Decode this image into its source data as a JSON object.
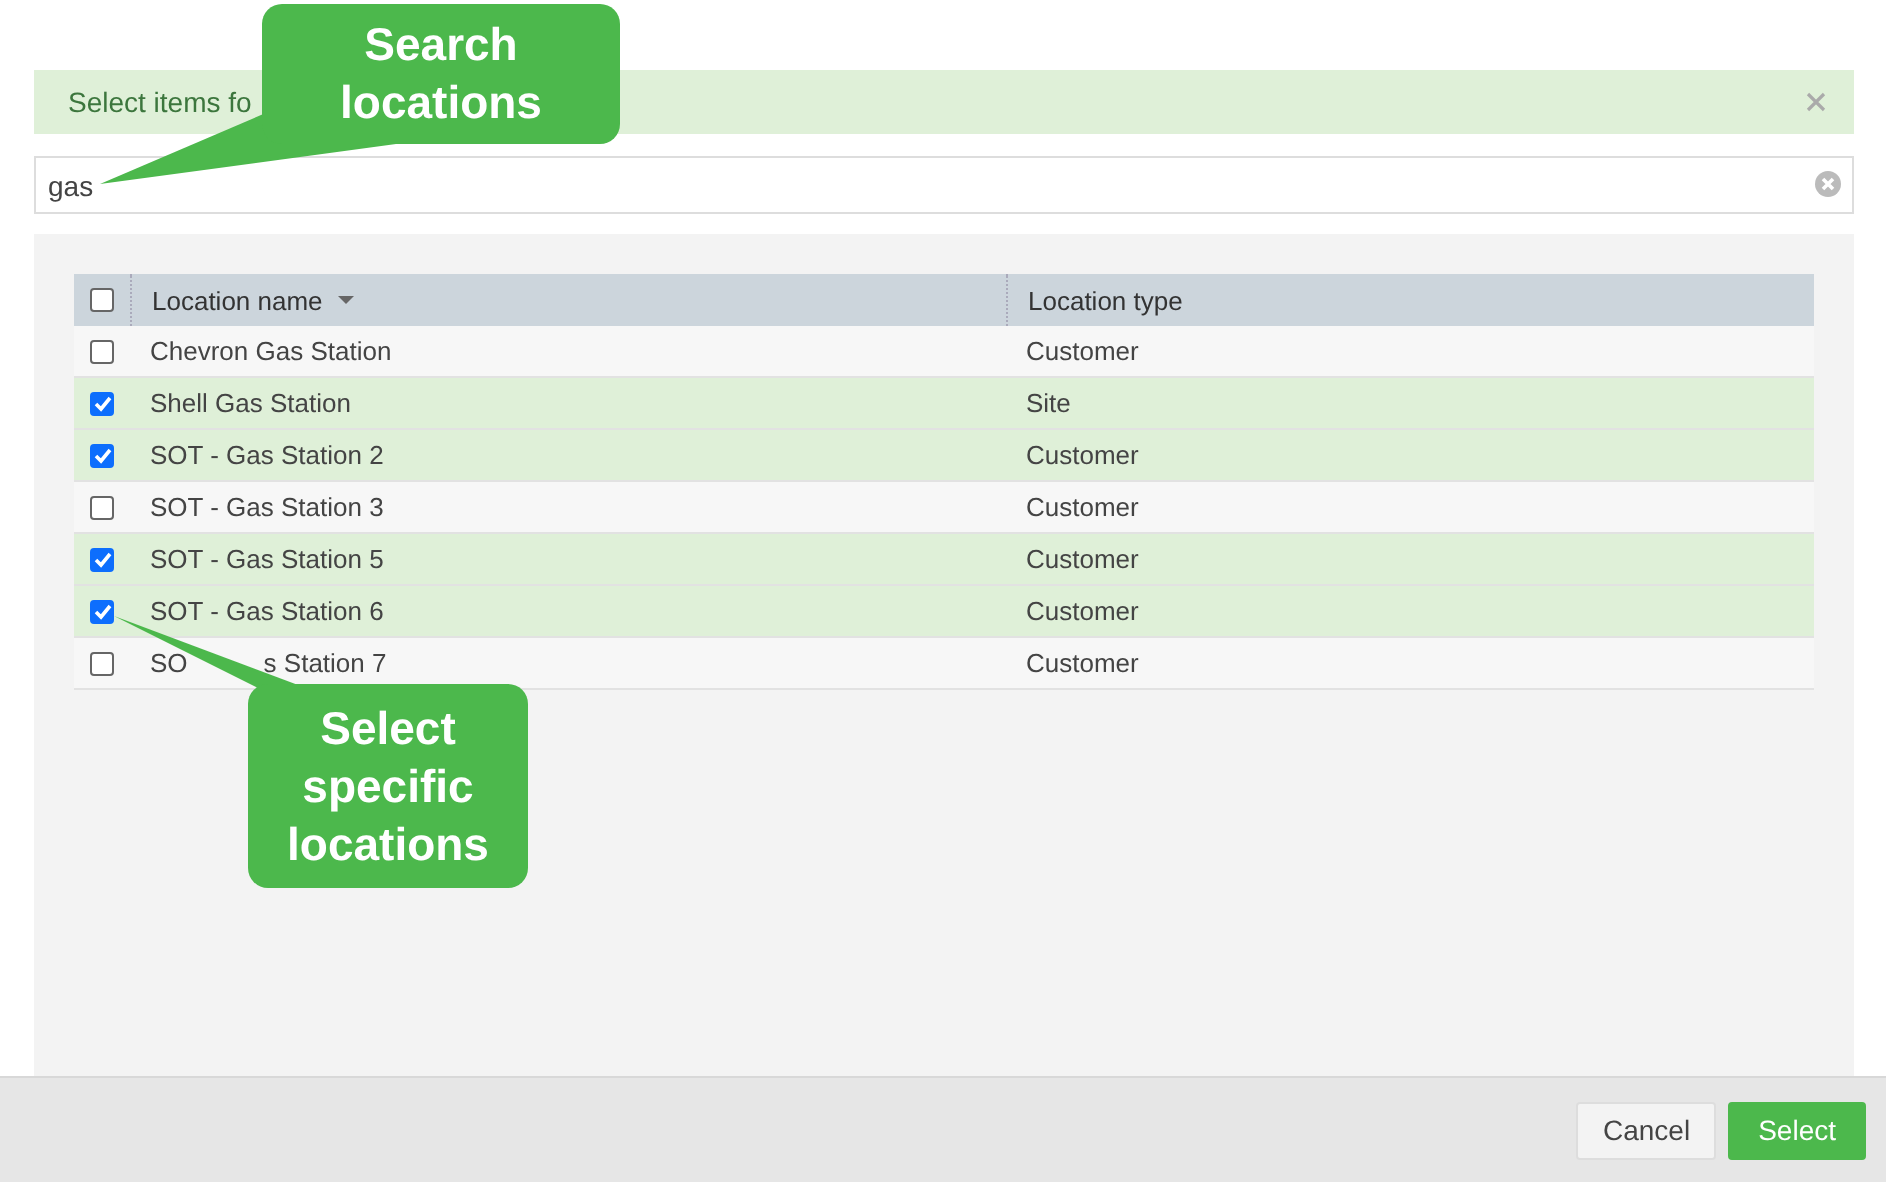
{
  "banner": {
    "text": "Select items fo"
  },
  "search": {
    "value": "gas"
  },
  "table": {
    "select_all_checked": false,
    "columns": [
      {
        "label": "Location name",
        "sorted": true
      },
      {
        "label": "Location type",
        "sorted": false
      }
    ],
    "rows": [
      {
        "name": "Chevron Gas Station",
        "type": "Customer",
        "selected": false
      },
      {
        "name": "Shell Gas Station",
        "type": "Site",
        "selected": true
      },
      {
        "name": "SOT - Gas Station 2",
        "type": "Customer",
        "selected": true
      },
      {
        "name": "SOT - Gas Station 3",
        "type": "Customer",
        "selected": false
      },
      {
        "name": "SOT - Gas Station 5",
        "type": "Customer",
        "selected": true
      },
      {
        "name": "SOT - Gas Station 6",
        "type": "Customer",
        "selected": true
      },
      {
        "name": "SO",
        "name_after_callout": "s Station 7",
        "type": "Customer",
        "selected": false
      }
    ]
  },
  "buttons": [
    {
      "label": "Cancel",
      "kind": "secondary"
    },
    {
      "label": "Select",
      "kind": "primary"
    }
  ],
  "callouts": [
    {
      "text": "Search\nlocations"
    },
    {
      "text": "Select\nspecific\nlocations"
    }
  ]
}
